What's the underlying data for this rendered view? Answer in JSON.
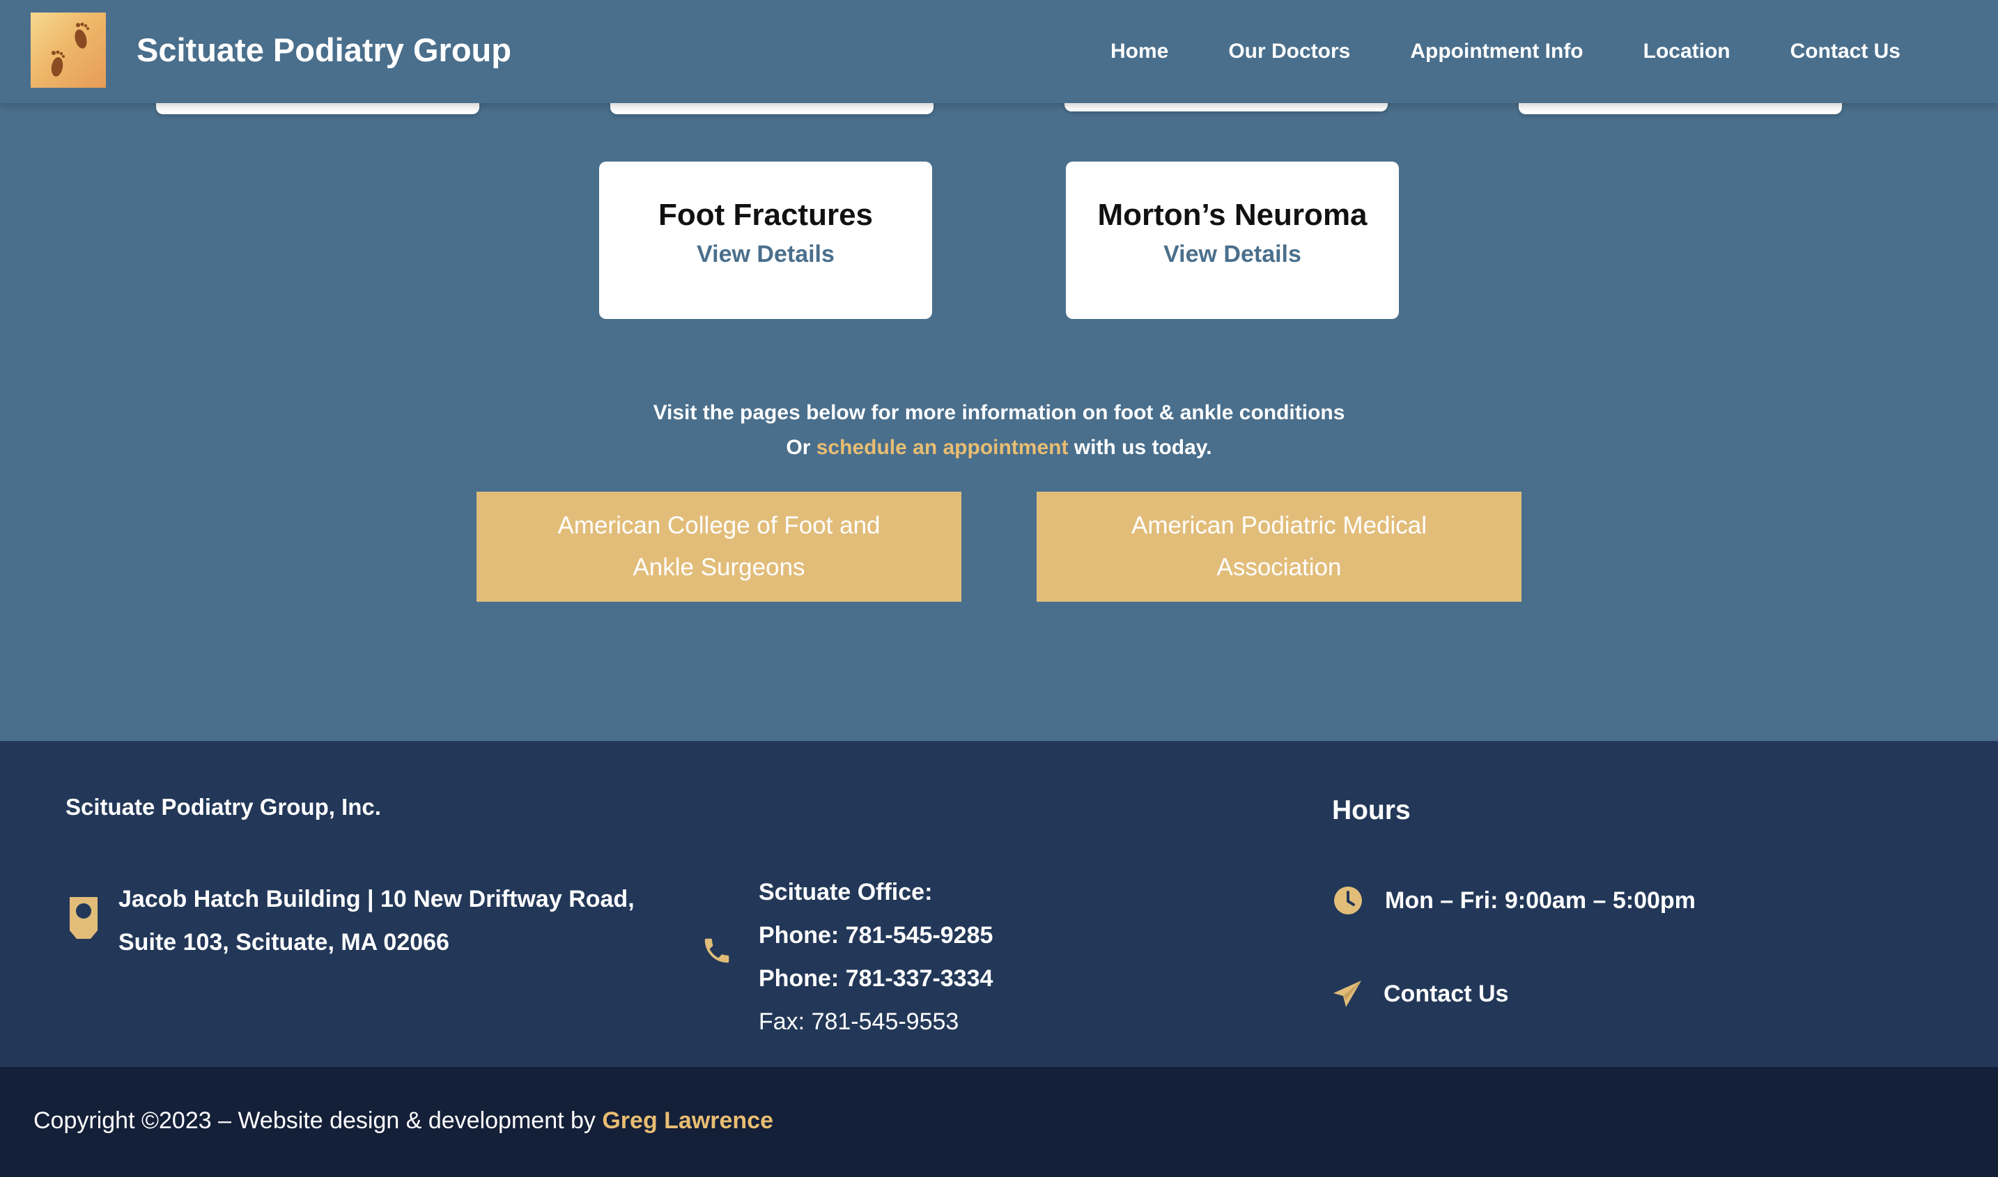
{
  "header": {
    "site_title": "Scituate Podiatry Group",
    "logo_icon": "footprints-logo",
    "nav": [
      {
        "label": "Home"
      },
      {
        "label": "Our Doctors"
      },
      {
        "label": "Appointment Info"
      },
      {
        "label": "Location"
      },
      {
        "label": "Contact Us"
      }
    ]
  },
  "conditions": [
    {
      "title": "Foot Fractures",
      "link": "View Details"
    },
    {
      "title": "Morton’s Neuroma",
      "link": "View Details"
    }
  ],
  "intro": {
    "line1": "Visit the pages below for more information on foot & ankle conditions",
    "line2_before": "Or ",
    "line2_link": "schedule an appointment",
    "line2_after": " with us today."
  },
  "resources": [
    {
      "label": "American College of Foot and Ankle Surgeons"
    },
    {
      "label": "American Podiatric Medical Association"
    }
  ],
  "footer": {
    "company": "Scituate Podiatry Group, Inc.",
    "address_icon": "map-marker-icon",
    "address_line1": "Jacob Hatch Building | 10 New Driftway Road,",
    "address_line2": "Suite 103, Scituate, MA 02066",
    "phone_icon": "phone-icon",
    "office_title": "Scituate Office:",
    "phone1": "Phone: 781-545-9285",
    "phone2": "Phone: 781-337-3334",
    "fax": "Fax: 781-545-9553",
    "hours_title": "Hours",
    "hours_icon": "clock-icon",
    "hours": "Mon – Fri: 9:00am – 5:00pm",
    "contact_icon": "paper-plane-icon",
    "contact": "Contact Us"
  },
  "bottom": {
    "copyright": "Copyright ©2023 – Website design & development by ",
    "author": "Greg Lawrence"
  },
  "colors": {
    "page_bg": "#4a6f8c",
    "footer_bg": "#233858",
    "bottom_bar_bg": "#141f38",
    "accent_gold": "#e2bd7a",
    "link_blue": "#4a6f8c"
  }
}
